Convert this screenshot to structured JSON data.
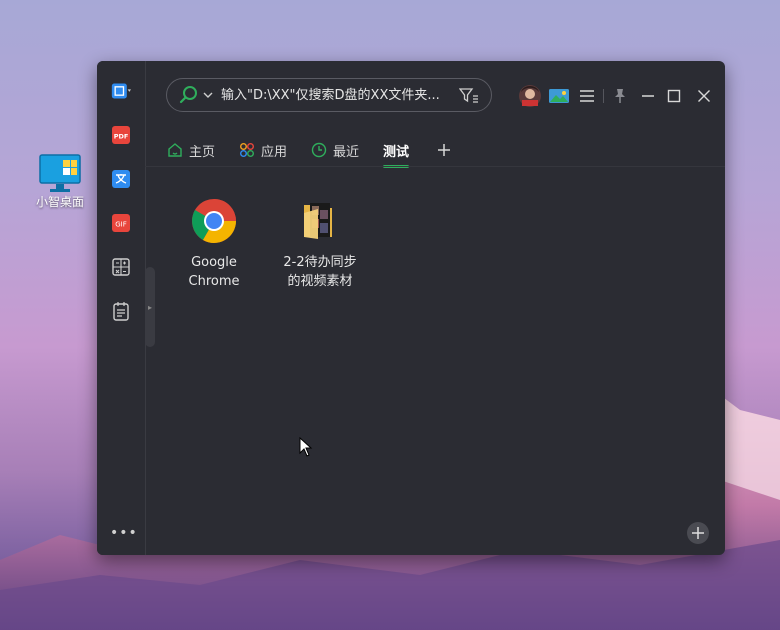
{
  "desktop": {
    "icon_label": "小智桌面"
  },
  "window": {
    "search": {
      "placeholder": "输入\"D:\\XX\"仅搜索D盘的XX文件夹..."
    },
    "tabs": [
      {
        "label": "主页",
        "active": false
      },
      {
        "label": "应用",
        "active": false
      },
      {
        "label": "最近",
        "active": false
      },
      {
        "label": "测试",
        "active": true
      }
    ],
    "items": [
      {
        "label_line1": "Google",
        "label_line2": "Chrome",
        "icon": "chrome-icon"
      },
      {
        "label_line1": "2-2待办同步",
        "label_line2": "的视频素材",
        "icon": "folder-icon"
      }
    ],
    "sidebar_tools": [
      "screenshot-icon",
      "pdf-icon",
      "translate-icon",
      "gif-icon",
      "calculator-icon",
      "notepad-icon"
    ],
    "colors": {
      "accent": "#2fae5c",
      "window_bg": "#2b2c33"
    }
  }
}
